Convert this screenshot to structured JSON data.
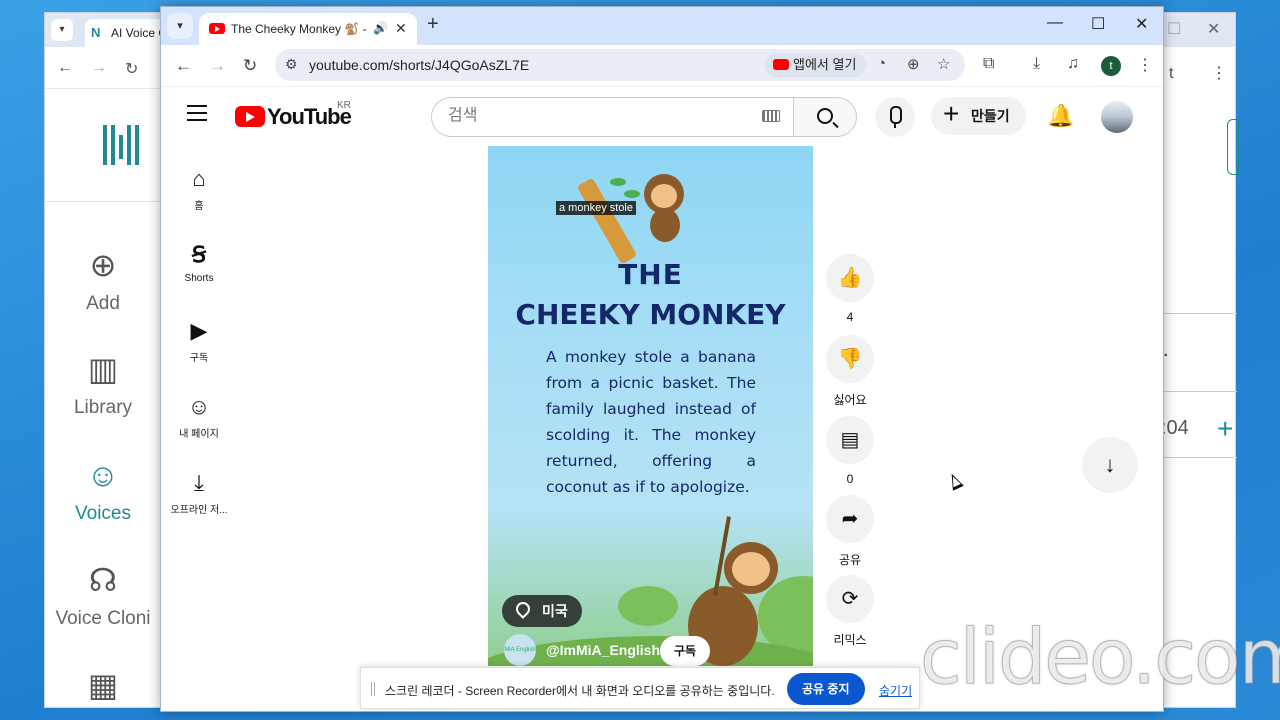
{
  "colors": {
    "accent": "#1f8a94",
    "yt_red": "#ff0000",
    "title_blue": "#15276b",
    "share_blue": "#0b57d0"
  },
  "bg_window": {
    "tab_title": "AI Voice C",
    "sidebar": [
      {
        "label": "Add",
        "icon": "add-circle-icon"
      },
      {
        "label": "Library",
        "icon": "library-icon"
      },
      {
        "label": "Voices",
        "icon": "voices-icon",
        "active": true
      },
      {
        "label": "Voice Cloni",
        "icon": "voice-clone-icon"
      }
    ],
    "right_fragment": ":04",
    "right_plus": "+",
    "right_dot": "."
  },
  "browser": {
    "tab_title": "The Cheeky Monkey 🐒 -",
    "url": "youtube.com/shorts/J4QGoAsZL7E",
    "open_in_app": "앱에서 열기",
    "profile_initial": "t"
  },
  "youtube": {
    "logo_text": "YouTube",
    "region": "KR",
    "search_placeholder": "검색",
    "create_label": "만들기",
    "sidebar": [
      {
        "label": "홈",
        "icon": "home-icon"
      },
      {
        "label": "Shorts",
        "icon": "shorts-icon"
      },
      {
        "label": "구독",
        "icon": "subscriptions-icon"
      },
      {
        "label": "내 페이지",
        "icon": "you-icon"
      },
      {
        "label": "오프라인 저...",
        "icon": "download-icon"
      }
    ]
  },
  "short": {
    "subtitle": "a monkey stole",
    "title_line1": "THE",
    "title_line2": "CHEEKY MONKEY",
    "story": "A monkey stole a banana from a picnic basket. The family laughed instead of scolding it. The monkey returned, offering a coconut as if to apologize.",
    "location": "미국",
    "channel": "@ImMiA_English",
    "subscribe": "구독",
    "channel_avatar_text": "MiA English"
  },
  "actions": {
    "like_count": "4",
    "dislike_label": "싫어요",
    "comment_count": "0",
    "share_label": "공유",
    "remix_label": "리믹스"
  },
  "share_banner": {
    "message": "스크린 레코더 - Screen Recorder에서 내 화면과 오디오를 공유하는 중입니다.",
    "stop_label": "공유 중지",
    "hide_label": "숨기기"
  },
  "watermark": "clideo.com"
}
